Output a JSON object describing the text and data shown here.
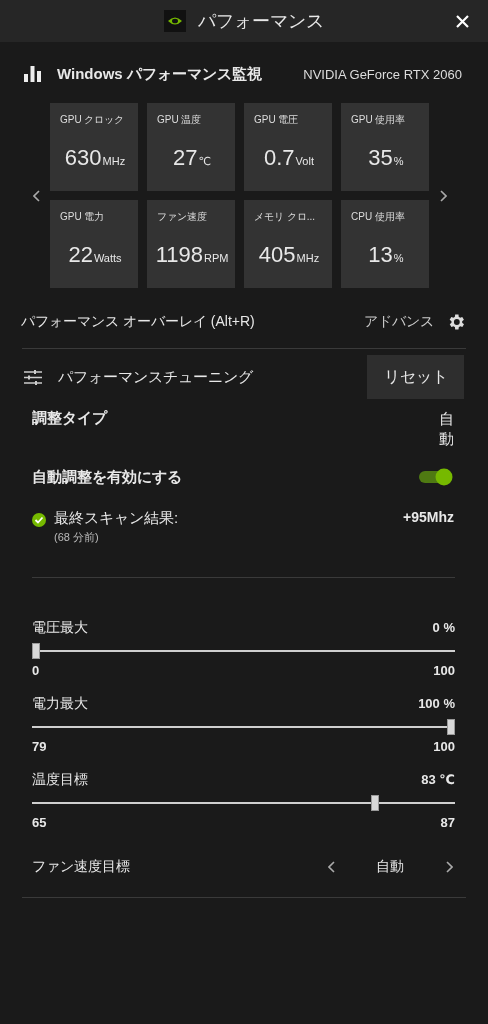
{
  "window": {
    "title": "パフォーマンス"
  },
  "monitor": {
    "title": "Windows パフォーマンス監視",
    "gpu_name": "NVIDIA GeForce RTX 2060",
    "metrics": [
      {
        "label": "GPU クロック",
        "value": "630",
        "unit": "MHz"
      },
      {
        "label": "GPU 温度",
        "value": "27",
        "unit": "℃"
      },
      {
        "label": "GPU 電圧",
        "value": "0.7",
        "unit": "Volt"
      },
      {
        "label": "GPU 使用率",
        "value": "35",
        "unit": "%"
      },
      {
        "label": "GPU 電力",
        "value": "22",
        "unit": "Watts"
      },
      {
        "label": "ファン速度",
        "value": "1198",
        "unit": "RPM"
      },
      {
        "label": "メモリ クロ...",
        "value": "405",
        "unit": "MHz"
      },
      {
        "label": "CPU 使用率",
        "value": "13",
        "unit": "%"
      }
    ]
  },
  "overlay": {
    "label": "パフォーマンス オーバーレイ (Alt+R)",
    "advanced": "アドバンス"
  },
  "tuning": {
    "title": "パフォーマンスチューニング",
    "reset": "リセット",
    "type_label": "調整タイプ",
    "type_value": "自動",
    "auto_label": "自動調整を有効にする",
    "auto_on": true,
    "scan_label": "最終スキャン結果:",
    "scan_time": "(68 分前)",
    "scan_result": "+95Mhz",
    "sliders": [
      {
        "label": "電圧最大",
        "reading": "0 %",
        "min": "0",
        "max": "100",
        "level": 0
      },
      {
        "label": "電力最大",
        "reading": "100 %",
        "min": "79",
        "max": "100",
        "level": 1
      },
      {
        "label": "温度目標",
        "reading": "83 ℃",
        "min": "65",
        "max": "87",
        "level": 0.818
      }
    ],
    "fan_label": "ファン速度目標",
    "fan_value": "自動"
  }
}
